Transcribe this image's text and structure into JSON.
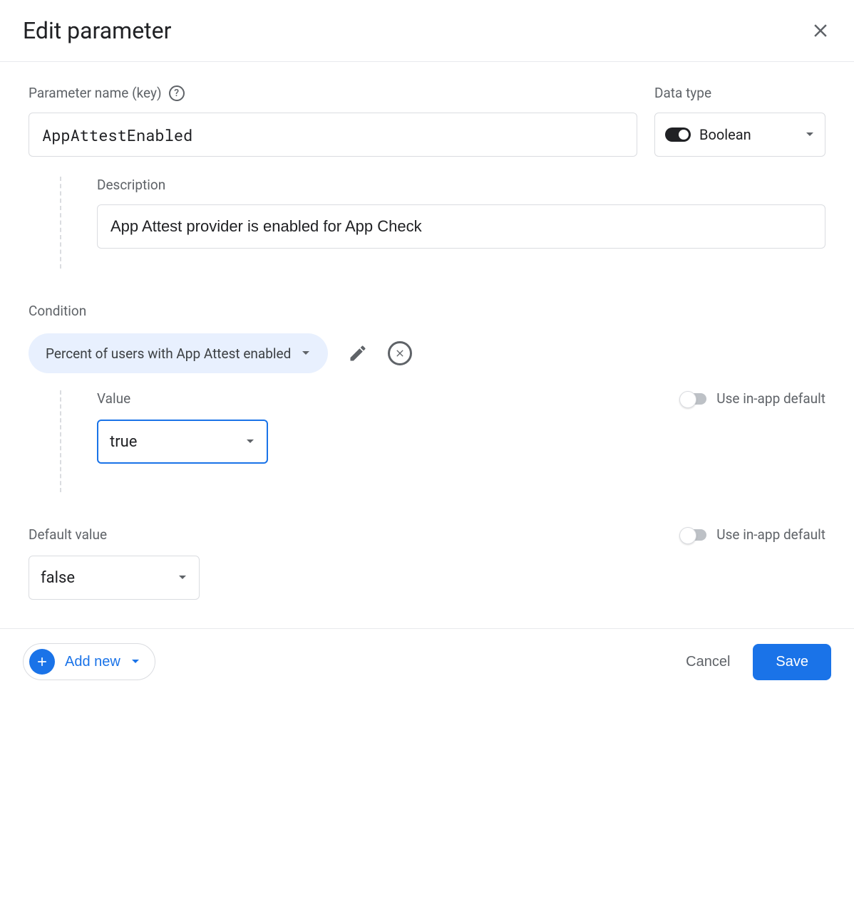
{
  "header": {
    "title": "Edit parameter"
  },
  "param": {
    "name_label": "Parameter name (key)",
    "name_value": "AppAttestEnabled",
    "datatype_label": "Data type",
    "datatype_value": "Boolean"
  },
  "description": {
    "label": "Description",
    "value": "App Attest provider is enabled for App Check"
  },
  "condition": {
    "label": "Condition",
    "chip_text": "Percent of users with App Attest enabled",
    "value_label": "Value",
    "value_selected": "true",
    "inapp_label": "Use in-app default"
  },
  "default": {
    "label": "Default value",
    "selected": "false",
    "inapp_label": "Use in-app default"
  },
  "footer": {
    "add_new": "Add new",
    "cancel": "Cancel",
    "save": "Save"
  }
}
